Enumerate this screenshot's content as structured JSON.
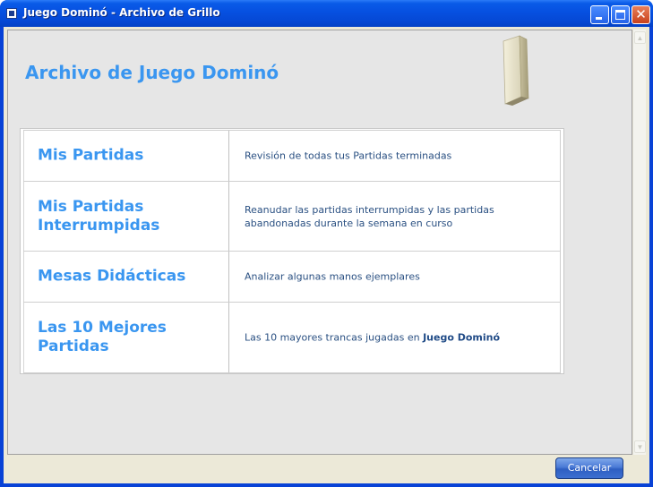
{
  "window": {
    "title": "Juego Dominó - Archivo de Grillo"
  },
  "page": {
    "title": "Archivo de Juego Dominó"
  },
  "options": [
    {
      "name": "Mis Partidas",
      "description": "Revisión de todas tus Partidas terminadas"
    },
    {
      "name": "Mis Partidas Interrumpidas",
      "description": "Reanudar las partidas interrumpidas y las partidas abandonadas durante la semana en curso"
    },
    {
      "name": "Mesas Didácticas",
      "description": "Analizar algunas manos ejemplares"
    },
    {
      "name": "Las 10 Mejores Partidas",
      "description_prefix": "Las 10 mayores trancas jugadas en ",
      "description_bold": "Juego Dominó"
    }
  ],
  "footer": {
    "cancel_label": "Cancelar"
  },
  "icons": {
    "app": "app-window-icon",
    "minimize": "minimize-icon",
    "maximize": "maximize-icon",
    "close": "close-icon",
    "domino": "domino-tile-icon"
  },
  "colors": {
    "titlebar": "#0650e0",
    "heading": "#3a96f0",
    "description": "#2a5082",
    "content_bg": "#e6e6e6"
  }
}
